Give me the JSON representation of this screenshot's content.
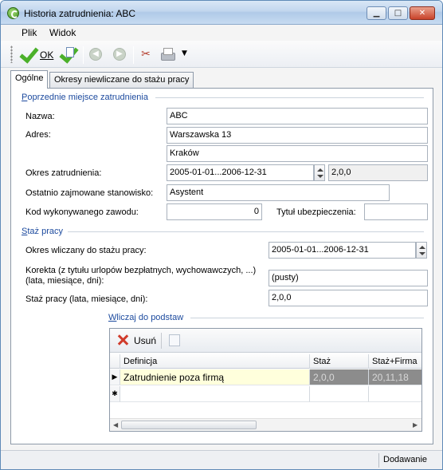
{
  "window": {
    "title": "Historia zatrudnienia: ABC",
    "min": "▁",
    "max": "□",
    "close": "✕"
  },
  "menu": [
    "Plik",
    "Widok"
  ],
  "toolbar": {
    "ok_label": "OK",
    "back": "◀",
    "forward": "▶",
    "tools": "✂",
    "dropdown": "▼"
  },
  "tabs": [
    "Ogólne",
    "Okresy niewliczane do stażu pracy"
  ],
  "poprzednie": {
    "title": "Poprzednie miejsce zatrudnienia",
    "nazwa_label": "Nazwa:",
    "nazwa": "ABC",
    "adres_label": "Adres:",
    "adres1": "Warszawska 13",
    "adres2": "Kraków",
    "okres_label": "Okres zatrudnienia:",
    "okres": "2005-01-01...2006-12-31",
    "okres_staz": "2,0,0",
    "stanowisko_label": "Ostatnio zajmowane stanowisko:",
    "stanowisko": "Asystent",
    "kod_label": "Kod wykonywanego zawodu:",
    "kod": "0",
    "tytul_label": "Tytuł ubezpieczenia:",
    "tytul": ""
  },
  "staz": {
    "title": "Staż pracy",
    "okres_label": "Okres wliczany do stażu pracy:",
    "okres": "2005-01-01...2006-12-31",
    "korekta_label1": "Korekta (z tytułu urlopów bezpłatnych, wychowawczych, ...)",
    "korekta_label2": "(lata, miesiące, dni):",
    "korekta": "(pusty)",
    "staz_label": "Staż pracy (lata, miesiące, dni):",
    "staz": "2,0,0"
  },
  "wliczaj": {
    "title": "Wliczaj do podstaw",
    "delete_label": "Usuń",
    "columns": [
      "Definicja",
      "Staż",
      "Staż+Firma"
    ],
    "rows": [
      {
        "definicja": "Zatrudnienie poza firmą",
        "staz": "2,0,0",
        "staz_firma": "20,11,18"
      }
    ],
    "row_marker": "▶",
    "new_row_marker": "✱",
    "scroll_left": "◀",
    "scroll_right": "▶"
  },
  "status": {
    "mode": "Dodawanie"
  }
}
